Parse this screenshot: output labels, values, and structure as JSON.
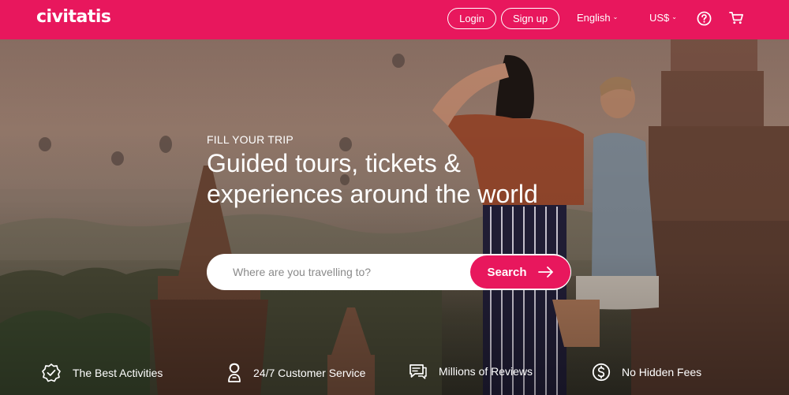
{
  "header": {
    "logo": "civitatis",
    "login_label": "Login",
    "signup_label": "Sign up",
    "language": "English",
    "currency": "US$",
    "help_icon": "help-circle-icon",
    "cart_icon": "cart-icon"
  },
  "hero": {
    "kicker": "FILL YOUR TRIP",
    "headline": "Guided tours, tickets & experiences around the world"
  },
  "search": {
    "placeholder": "Where are you travelling to?",
    "button_label": "Search"
  },
  "features": [
    {
      "label": "The Best Activities",
      "icon": "badge-check-icon"
    },
    {
      "label": "24/7 Customer Service",
      "icon": "support-agent-icon"
    },
    {
      "label": "Millions of Reviews",
      "icon": "reviews-icon"
    },
    {
      "label": "No Hidden Fees",
      "icon": "dollar-circle-icon"
    }
  ],
  "colors": {
    "brand": "#e8175d",
    "text_on_brand": "#ffffff"
  }
}
